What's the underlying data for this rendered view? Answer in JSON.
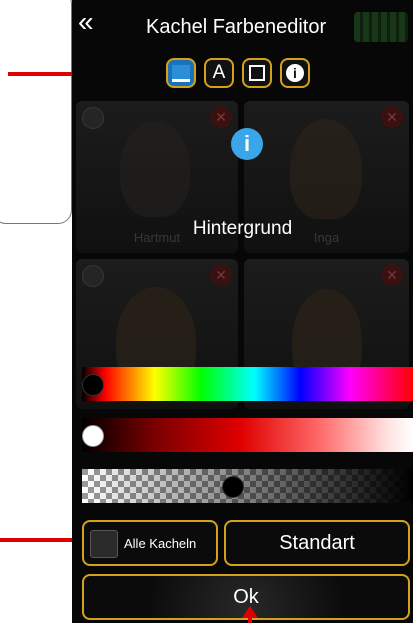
{
  "app": {
    "title": "Kachel Farbeneditor",
    "back_icon": "double-chevron-left-icon"
  },
  "mode_buttons": [
    {
      "icon": "fill-color-icon",
      "active": true
    },
    {
      "icon": "text-color-icon",
      "label": "A",
      "active": false
    },
    {
      "icon": "border-color-icon",
      "active": false
    },
    {
      "icon": "info-icon",
      "label": "i",
      "active": false
    }
  ],
  "background_tiles": [
    {
      "name": "Hartmut"
    },
    {
      "name": "Inga"
    },
    {
      "name": ""
    },
    {
      "name": ""
    }
  ],
  "selected_field": {
    "icon": "info-icon",
    "icon_glyph": "i",
    "label": "Hintergrund"
  },
  "sliders": {
    "hue": {
      "value": 0.0
    },
    "brightness": {
      "value": 0.0
    },
    "alpha": {
      "value": 0.45
    }
  },
  "buttons": {
    "all_tiles_label": "Alle Kacheln",
    "all_tiles_checked": false,
    "standard_label": "Standart",
    "ok_label": "Ok"
  },
  "colors": {
    "accent_border": "#d3a21c",
    "active_mode": "#1a73b8",
    "info_blue": "#3aa5e8",
    "annotation_red": "#e00000"
  }
}
